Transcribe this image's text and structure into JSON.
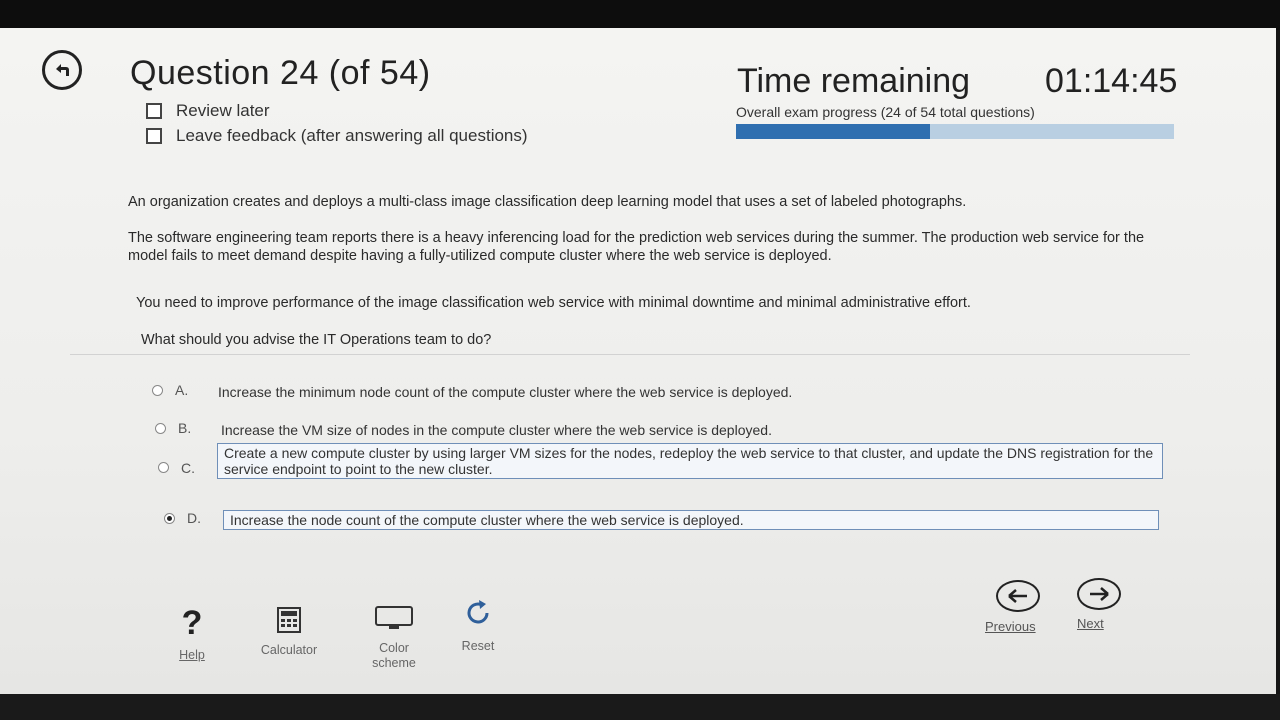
{
  "header": {
    "title": "Question 24 (of 54)",
    "review_later": "Review later",
    "leave_feedback": "Leave feedback (after answering all questions)",
    "time_label": "Time remaining",
    "time_value": "01:14:45",
    "progress_text": "Overall exam progress (24 of 54 total questions)",
    "progress_fraction": 0.444
  },
  "question": {
    "p1": "An organization creates and deploys a multi-class image classification deep learning model that uses a set of labeled photographs.",
    "p2": "The software engineering team reports there is a heavy inferencing load for the prediction web services during the summer. The production web service for the model fails to meet demand despite having a fully-utilized compute cluster where the web service is deployed.",
    "p3": "You need to improve performance of the image classification web service with minimal downtime and minimal administrative effort.",
    "p4": "What should you advise the IT Operations team to do?"
  },
  "options": [
    {
      "letter": "A.",
      "text": "Increase the minimum node count of the compute cluster where the web service is deployed.",
      "selected": false
    },
    {
      "letter": "B.",
      "text": "Increase the VM size of nodes in the compute cluster where the web service is deployed.",
      "selected": false
    },
    {
      "letter": "C.",
      "text": "Create a new compute cluster by using larger VM sizes for the nodes, redeploy the web service to that cluster, and update the DNS registration for the service endpoint to point to the new cluster.",
      "selected": false
    },
    {
      "letter": "D.",
      "text": "Increase the node count of the compute cluster where the web service is deployed.",
      "selected": true
    }
  ],
  "toolbar": {
    "help": "Help",
    "calculator": "Calculator",
    "color_scheme": "Color scheme",
    "reset": "Reset",
    "previous": "Previous",
    "next": "Next"
  },
  "icons": [
    "back-icon",
    "checkbox-icon",
    "help-icon",
    "calculator-icon",
    "monitor-icon",
    "reset-icon",
    "arrow-left-icon",
    "arrow-right-icon"
  ],
  "colors": {
    "progress_fill": "#2f6fb0",
    "progress_track": "#b9cfe2"
  }
}
